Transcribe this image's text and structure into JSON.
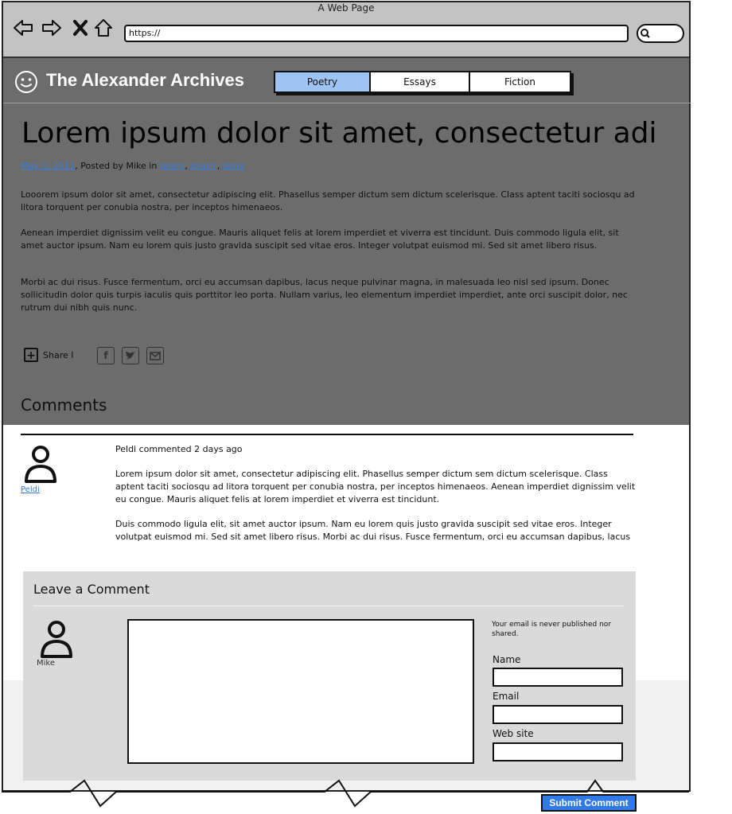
{
  "browser": {
    "window_title": "A Web Page",
    "url": "https://"
  },
  "site": {
    "title": "The Alexander Archives",
    "nav_tabs": [
      {
        "label": "Poetry",
        "active": true
      },
      {
        "label": "Essays",
        "active": false
      },
      {
        "label": "Fiction",
        "active": false
      }
    ]
  },
  "post": {
    "title": "Lorem ipsum dolor sit amet, consectetur adi",
    "date": "May 1, 2011",
    "posted_by": ", Posted by Mike in ",
    "tags": [
      "lorem",
      "ipsum",
      "dolor"
    ],
    "paragraphs": [
      "Looorem ipsum dolor sit amet, consectetur adipiscing elit. Phasellus semper dictum sem dictum scelerisque. Class aptent taciti sociosqu ad litora torquent per conubia nostra, per inceptos himenaeos.",
      "Aenean imperdiet dignissim velit eu congue. Mauris aliquet felis at lorem imperdiet et viverra est tincidunt. Duis commodo ligula elit, sit amet auctor ipsum. Nam eu lorem quis justo gravida suscipit sed vitae eros. Integer volutpat euismod mi. Sed sit amet libero risus.",
      "Morbi ac dui risus. Fusce fermentum, orci eu accumsan dapibus, lacus neque pulvinar magna, in malesuada leo nisl sed ipsum. Donec sollicitudin dolor quis turpis iaculis quis porttitor leo porta. Nullam varius, leo elementum imperdiet imperdiet, ante orci suscipit dolor, nec rutrum dui nibh quis nunc."
    ],
    "share_label": "Share I"
  },
  "comments": {
    "heading": "Comments",
    "items": [
      {
        "author": "Peldi",
        "header": "Peldi commented 2 days ago",
        "paragraphs": [
          "Lorem ipsum dolor sit amet, consectetur adipiscing elit. Phasellus semper dictum sem dictum scelerisque. Class aptent taciti sociosqu ad litora torquent per conubia nostra, per inceptos himenaeos. Aenean imperdiet dignissim velit eu congue. Mauris aliquet felis at lorem imperdiet et viverra est tincidunt.",
          "Duis commodo ligula elit, sit amet auctor ipsum. Nam eu lorem quis justo gravida suscipit sed vitae eros. Integer volutpat euismod mi. Sed sit amet libero risus. Morbi ac dui risus. Fusce fermentum, orci eu accumsan dapibus, lacus neque pulvinar magna, in malesuada leo nisl sed ipsum."
        ]
      }
    ]
  },
  "leave_comment": {
    "title": "Leave a Comment",
    "user_name": "Mike",
    "email_note": "Your email is never published nor shared.",
    "name_label": "Name",
    "email_label": "Email",
    "website_label": "Web site",
    "submit_label": "Submit Comment"
  },
  "colors": {
    "active_tab": "#9fc3f2",
    "link": "#3d7bd6",
    "submit": "#2f79e8"
  }
}
